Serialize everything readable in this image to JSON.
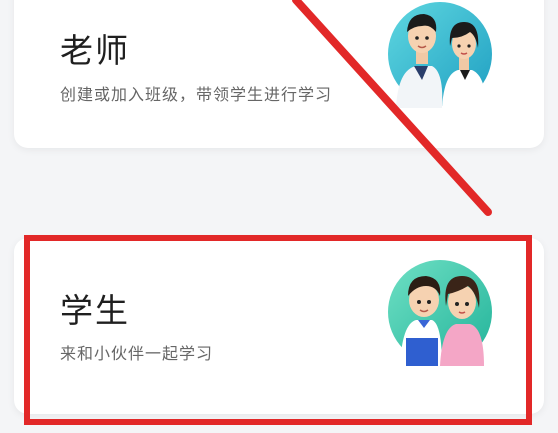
{
  "roles": [
    {
      "title": "老师",
      "description": "创建或加入班级，带领学生进行学习",
      "avatar_icon": "teacher-couple-avatar"
    },
    {
      "title": "学生",
      "description": "来和小伙伴一起学习",
      "avatar_icon": "student-couple-avatar"
    }
  ],
  "annotation": {
    "strike_color": "#e22828",
    "highlight_color": "#e22828"
  }
}
